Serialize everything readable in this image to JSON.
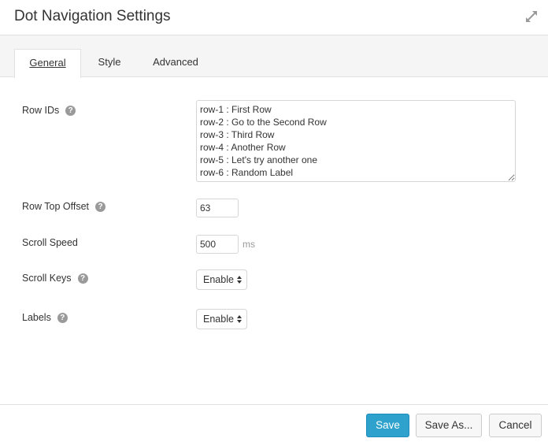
{
  "header": {
    "title": "Dot Navigation Settings",
    "expand_icon": "expand-arrows-icon"
  },
  "tabs": [
    {
      "label": "General",
      "active": true
    },
    {
      "label": "Style",
      "active": false
    },
    {
      "label": "Advanced",
      "active": false
    }
  ],
  "form": {
    "row_ids": {
      "label": "Row IDs",
      "value": "row-1 : First Row\nrow-2 : Go to the Second Row\nrow-3 : Third Row\nrow-4 : Another Row\nrow-5 : Let's try another one\nrow-6 : Random Label"
    },
    "row_top_offset": {
      "label": "Row Top Offset",
      "value": "63"
    },
    "scroll_speed": {
      "label": "Scroll Speed",
      "value": "500",
      "unit": "ms"
    },
    "scroll_keys": {
      "label": "Scroll Keys",
      "value": "Enable"
    },
    "labels": {
      "label": "Labels",
      "value": "Enable"
    },
    "help_glyph": "?"
  },
  "footer": {
    "save": "Save",
    "save_as": "Save As...",
    "cancel": "Cancel"
  },
  "colors": {
    "primary": "#2ea2cc",
    "tab_bar": "#f5f5f5",
    "help_icon": "#9a9a9a"
  }
}
